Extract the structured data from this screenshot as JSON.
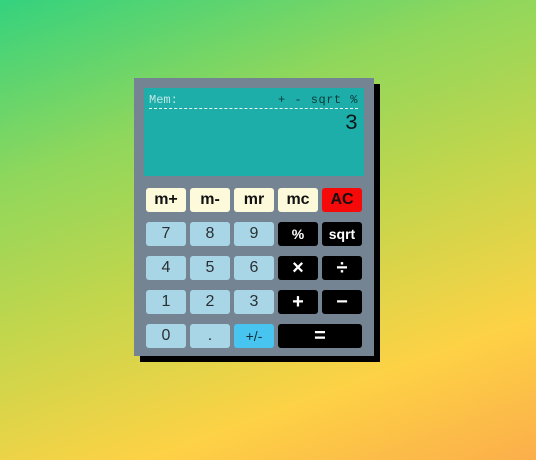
{
  "display": {
    "memory_label": "Mem:",
    "operators_indicator": "+ - sqrt %",
    "value": "3"
  },
  "buttons": {
    "m_plus": "m+",
    "m_minus": "m-",
    "mr": "mr",
    "mc": "mc",
    "ac": "AC",
    "seven": "7",
    "eight": "8",
    "nine": "9",
    "percent": "%",
    "sqrt": "sqrt",
    "four": "4",
    "five": "5",
    "six": "6",
    "multiply": "×",
    "divide": "÷",
    "one": "1",
    "two": "2",
    "three": "3",
    "plus": "+",
    "minus": "−",
    "zero": "0",
    "decimal": ".",
    "sign": "+/-",
    "equals": "="
  },
  "colors": {
    "body": "#748493",
    "display": "#1eaeaa",
    "memory_button": "#fdfadb",
    "clear_button": "#f50909",
    "number_button": "#a9d6e6",
    "sign_button": "#47c4f0",
    "operator_button": "#000000"
  }
}
